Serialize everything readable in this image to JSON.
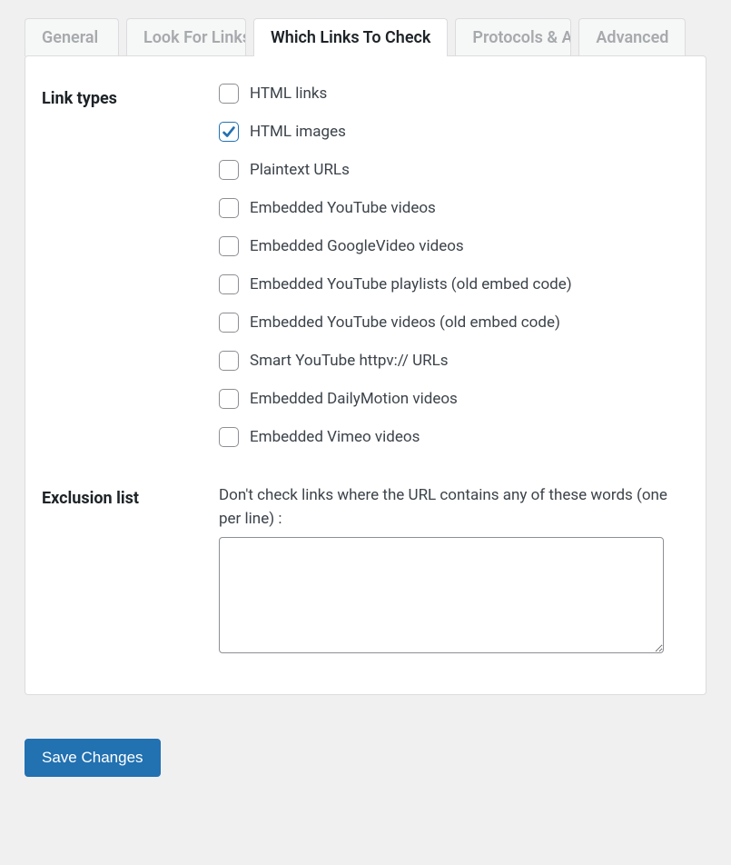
{
  "tabs": {
    "t1": "General",
    "t2": "Look For Links In",
    "t3": "Which Links To Check",
    "t4": "Protocols & APIs",
    "t5": "Advanced"
  },
  "sections": {
    "link_types": {
      "heading": "Link types",
      "items": [
        {
          "label": "HTML links",
          "checked": false
        },
        {
          "label": "HTML images",
          "checked": true
        },
        {
          "label": "Plaintext URLs",
          "checked": false
        },
        {
          "label": "Embedded YouTube videos",
          "checked": false
        },
        {
          "label": "Embedded GoogleVideo videos",
          "checked": false
        },
        {
          "label": "Embedded YouTube playlists (old embed code)",
          "checked": false
        },
        {
          "label": "Embedded YouTube videos (old embed code)",
          "checked": false
        },
        {
          "label": "Smart YouTube httpv:// URLs",
          "checked": false
        },
        {
          "label": "Embedded DailyMotion videos",
          "checked": false
        },
        {
          "label": "Embedded Vimeo videos",
          "checked": false
        }
      ]
    },
    "exclusion_list": {
      "heading": "Exclusion list",
      "description": "Don't check links where the URL contains any of these words (one per line) :",
      "value": ""
    }
  },
  "buttons": {
    "save": "Save Changes"
  }
}
